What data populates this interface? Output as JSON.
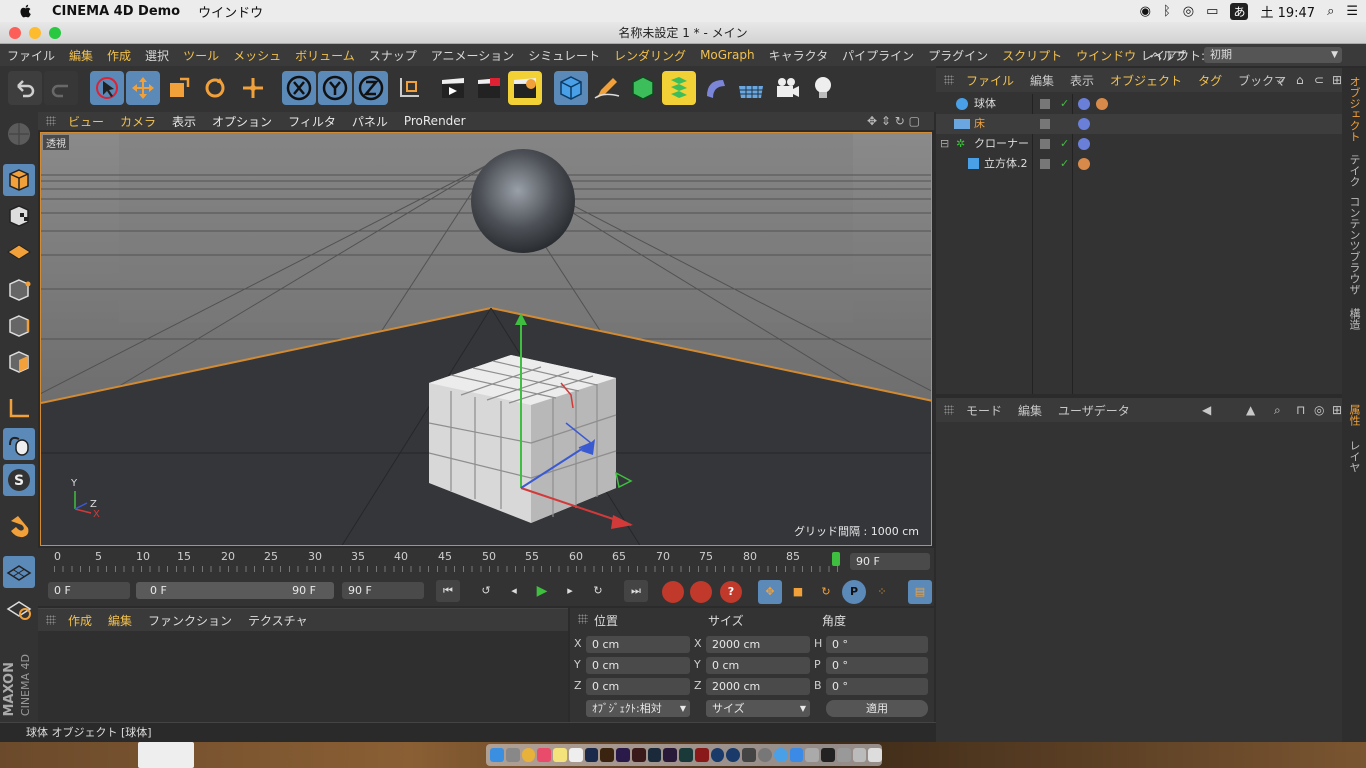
{
  "mac_menubar": {
    "app_name": "CINEMA 4D Demo",
    "menu_window": "ウインドウ",
    "clock": "土 19:47",
    "ime_label": "あ"
  },
  "window": {
    "title": "名称未設定 1 * - メイン"
  },
  "main_menu": [
    "ファイル",
    "編集",
    "作成",
    "選択",
    "ツール",
    "メッシュ",
    "ボリューム",
    "スナップ",
    "アニメーション",
    "シミュレート",
    "レンダリング",
    "MoGraph",
    "キャラクタ",
    "パイプライン",
    "プラグイン",
    "スクリプト",
    "ウインドウ",
    "ヘルプ"
  ],
  "highlighted_menus": [
    "編集",
    "作成",
    "ツール",
    "メッシュ",
    "ボリューム",
    "レンダリング",
    "MoGraph",
    "スクリプト",
    "ウインドウ"
  ],
  "layout": {
    "label": "レイアウト:",
    "value": "初期"
  },
  "viewport": {
    "menu": [
      "ビュー",
      "カメラ",
      "表示",
      "オプション",
      "フィルタ",
      "パネル",
      "ProRender"
    ],
    "camera_label": "透視",
    "grid_spacing": "グリッド間隔 : 1000 cm",
    "axis_y": "Y",
    "axis_z": "Z",
    "axis_x": "X"
  },
  "timeline": {
    "ticks": [
      "0",
      "5",
      "10",
      "15",
      "20",
      "25",
      "30",
      "35",
      "40",
      "45",
      "50",
      "55",
      "60",
      "65",
      "70",
      "75",
      "80",
      "85"
    ],
    "end_frame": "90 F",
    "current": "0 F",
    "range_start": "0 F",
    "range_end": "90 F",
    "max_frame": "90 F"
  },
  "material_panel": {
    "menu": [
      "作成",
      "編集",
      "ファンクション",
      "テクスチャ"
    ]
  },
  "coordinates": {
    "headers": [
      "位置",
      "サイズ",
      "角度"
    ],
    "rows": [
      {
        "axis": "X",
        "pos": "0 cm",
        "size_axis": "X",
        "size": "2000 cm",
        "rot_axis": "H",
        "rot": "0 °"
      },
      {
        "axis": "Y",
        "pos": "0 cm",
        "size_axis": "Y",
        "size": "0 cm",
        "rot_axis": "P",
        "rot": "0 °"
      },
      {
        "axis": "Z",
        "pos": "0 cm",
        "size_axis": "Z",
        "size": "2000 cm",
        "rot_axis": "B",
        "rot": "0 °"
      }
    ],
    "mode_select": "ｵﾌﾞｼﾞｪｸﾄ:相対",
    "size_select": "サイズ",
    "apply_button": "適用"
  },
  "status": {
    "text": "球体 オブジェクト [球体]"
  },
  "object_manager": {
    "menu": [
      "ファイル",
      "編集",
      "表示",
      "オブジェクト",
      "タグ",
      "ブックマ"
    ],
    "objects": [
      {
        "name": "球体",
        "selected": false
      },
      {
        "name": "床",
        "selected": true
      },
      {
        "name": "クローナー",
        "selected": false
      },
      {
        "name": "立方体.2",
        "selected": false
      }
    ]
  },
  "attribute_manager": {
    "menu": [
      "モード",
      "編集",
      "ユーザデータ"
    ]
  },
  "side_tabs_top": [
    "オブジェクト",
    "テイク",
    "コンテンツブラウザ",
    "構造"
  ],
  "side_tabs_bottom": [
    "属性",
    "レイヤ"
  ],
  "brand": {
    "maxon": "MAXON",
    "product": "CINEMA 4D"
  },
  "colors": {
    "accent": "#f2c14e",
    "selection_orange": "#d28a33",
    "panel_bg": "#333333",
    "active_blue": "#3d86c6"
  }
}
